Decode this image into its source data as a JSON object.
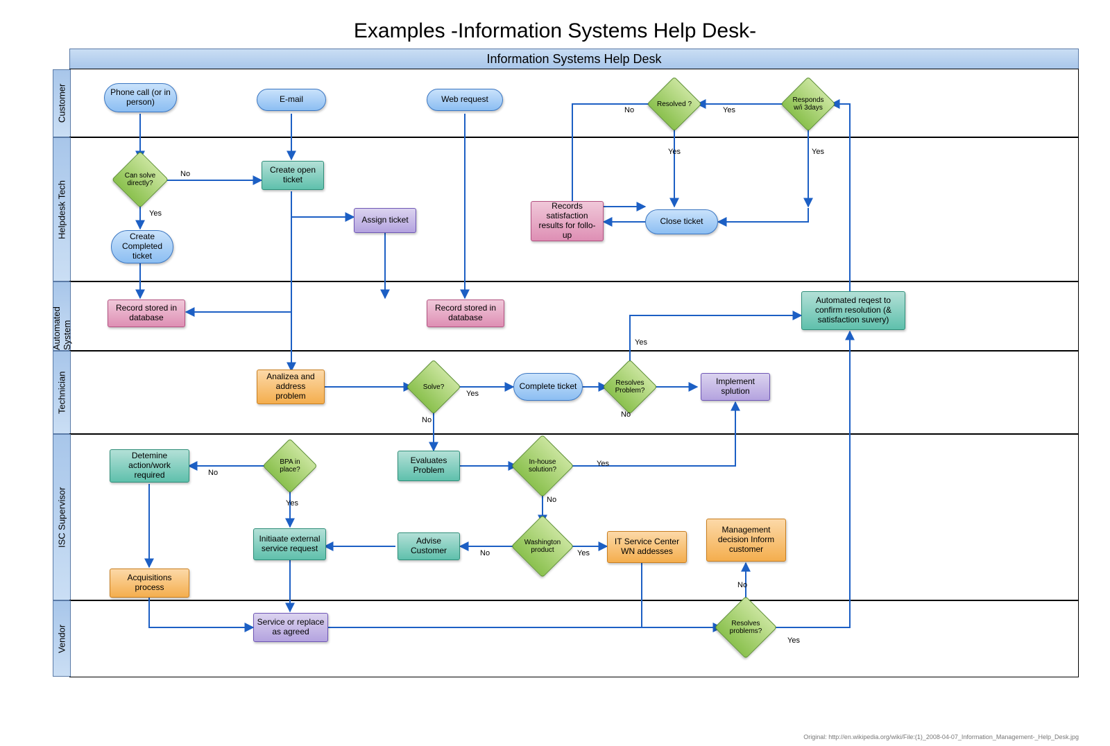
{
  "title": "Examples -Information Systems Help Desk-",
  "pool_title": "Information Systems Help Desk",
  "lanes": {
    "customer": "Customer",
    "helpdesk": "Helpdesk Tech",
    "automated": "Automated System",
    "technician": "Technician",
    "supervisor": "ISC Supervisor",
    "vendor": "Vendor"
  },
  "nodes": {
    "phone": "Phone call\n(or in person)",
    "email": "E-mail",
    "web": "Web request",
    "resolved": "Resolved ?",
    "responds": "Responds w/i 3days",
    "can_solve": "Can solve directly?",
    "create_open": "Create open ticket",
    "assign": "Assign ticket",
    "close": "Close ticket",
    "satisfaction": "Records satisfaction results for follo-up",
    "create_comp": "Create Completed ticket",
    "record1": "Record stored in database",
    "record2": "Record stored in database",
    "auto_req": "Automated reqest to confirm resolution (& satisfaction suvery)",
    "analyze": "Analizea and address problem",
    "solve": "Solve?",
    "complete": "Complete ticket",
    "resolves_prob": "Resolves Problem?",
    "implement": "Implement splution",
    "determine": "Detemine action/work required",
    "bpa": "BPA in place?",
    "evaluates": "Evaluates Problem",
    "inhouse": "In-house solution?",
    "initiate": "Initiaate external service request",
    "advise": "Advise Customer",
    "washington": "Washington product",
    "mgmt": "Management decision Inform customer",
    "itcenter": "IT Service Center WN addesses",
    "acq": "Acquisitions process",
    "service": "Service or replace as agreed",
    "resolves2": "Resolves problems?"
  },
  "labels": {
    "yes": "Yes",
    "no": "No"
  },
  "footer": "Original: http://en.wikipedia.org/wiki/File:(1)_2008-04-07_Information_Management-_Help_Desk.jpg"
}
